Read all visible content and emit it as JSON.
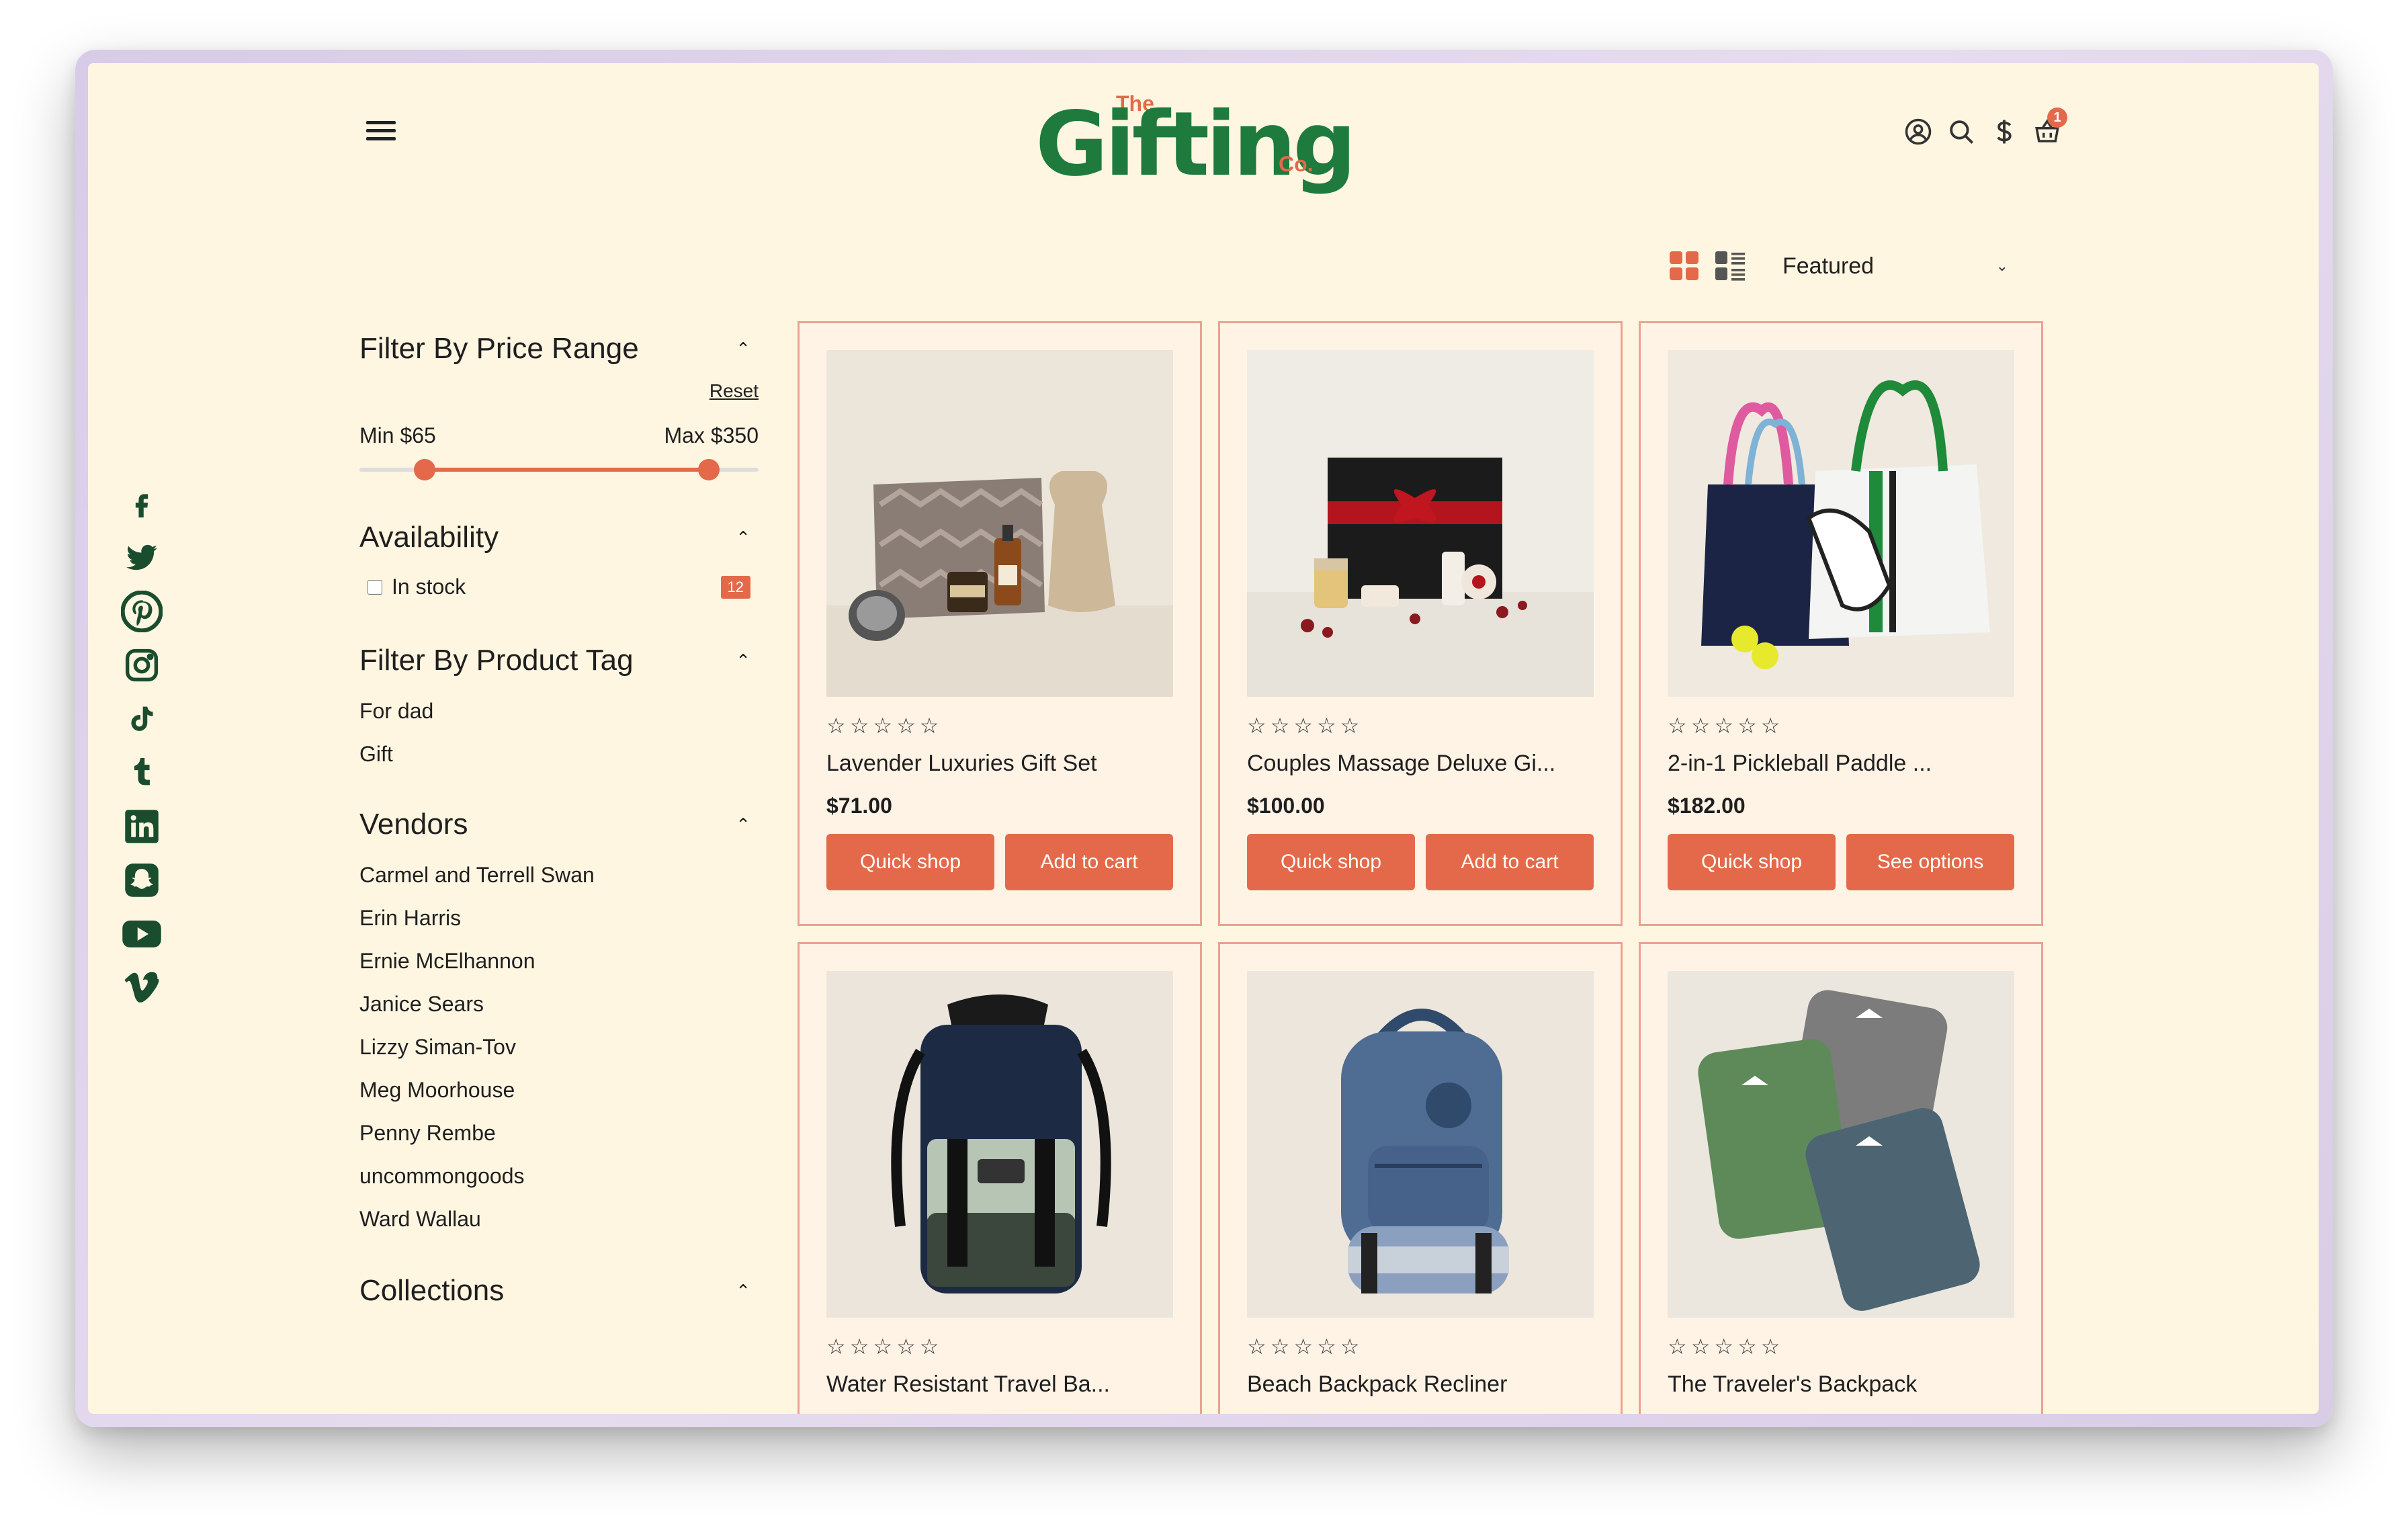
{
  "brand": {
    "prefix": "The",
    "name": "Gifting",
    "suffix": "Co."
  },
  "header": {
    "cart_count": "1"
  },
  "toolbar": {
    "sort_selected": "Featured"
  },
  "filters": {
    "price": {
      "title": "Filter By Price Range",
      "reset": "Reset",
      "min_label": "Min $65",
      "max_label": "Max $350",
      "min_value": 65,
      "max_value": 350,
      "range_min": 0,
      "range_max": 400
    },
    "availability": {
      "title": "Availability",
      "option": "In stock",
      "count": "12"
    },
    "tags": {
      "title": "Filter By Product Tag",
      "items": [
        "For dad",
        "Gift"
      ]
    },
    "vendors": {
      "title": "Vendors",
      "items": [
        "Carmel and Terrell Swan",
        "Erin Harris",
        "Ernie McElhannon",
        "Janice Sears",
        "Lizzy Siman-Tov",
        "Meg Moorhouse",
        "Penny Rembe",
        "uncommongoods",
        "Ward Wallau"
      ]
    },
    "collections": {
      "title": "Collections"
    }
  },
  "social": [
    "facebook-icon",
    "twitter-icon",
    "pinterest-icon",
    "instagram-icon",
    "tiktok-icon",
    "tumblr-icon",
    "linkedin-icon",
    "snapchat-icon",
    "youtube-icon",
    "vimeo-icon"
  ],
  "products": [
    {
      "title": "Lavender Luxuries Gift Set",
      "price": "$71.00",
      "btn1": "Quick shop",
      "btn2": "Add to cart",
      "stars": "☆☆☆☆☆"
    },
    {
      "title": "Couples Massage Deluxe Gi...",
      "price": "$100.00",
      "btn1": "Quick shop",
      "btn2": "Add to cart",
      "stars": "☆☆☆☆☆"
    },
    {
      "title": "2-in-1 Pickleball Paddle ...",
      "price": "$182.00",
      "btn1": "Quick shop",
      "btn2": "See options",
      "stars": "☆☆☆☆☆"
    },
    {
      "title": "Water Resistant Travel Ba...",
      "stars": "☆☆☆☆☆"
    },
    {
      "title": "Beach Backpack Recliner",
      "stars": "☆☆☆☆☆"
    },
    {
      "title": "The Traveler's Backpack",
      "stars": "☆☆☆☆☆"
    }
  ],
  "colors": {
    "accent": "#e4694a",
    "brand_green": "#1f7a3e",
    "social_green": "#1a4d2e",
    "page_bg": "#fff6e2"
  }
}
